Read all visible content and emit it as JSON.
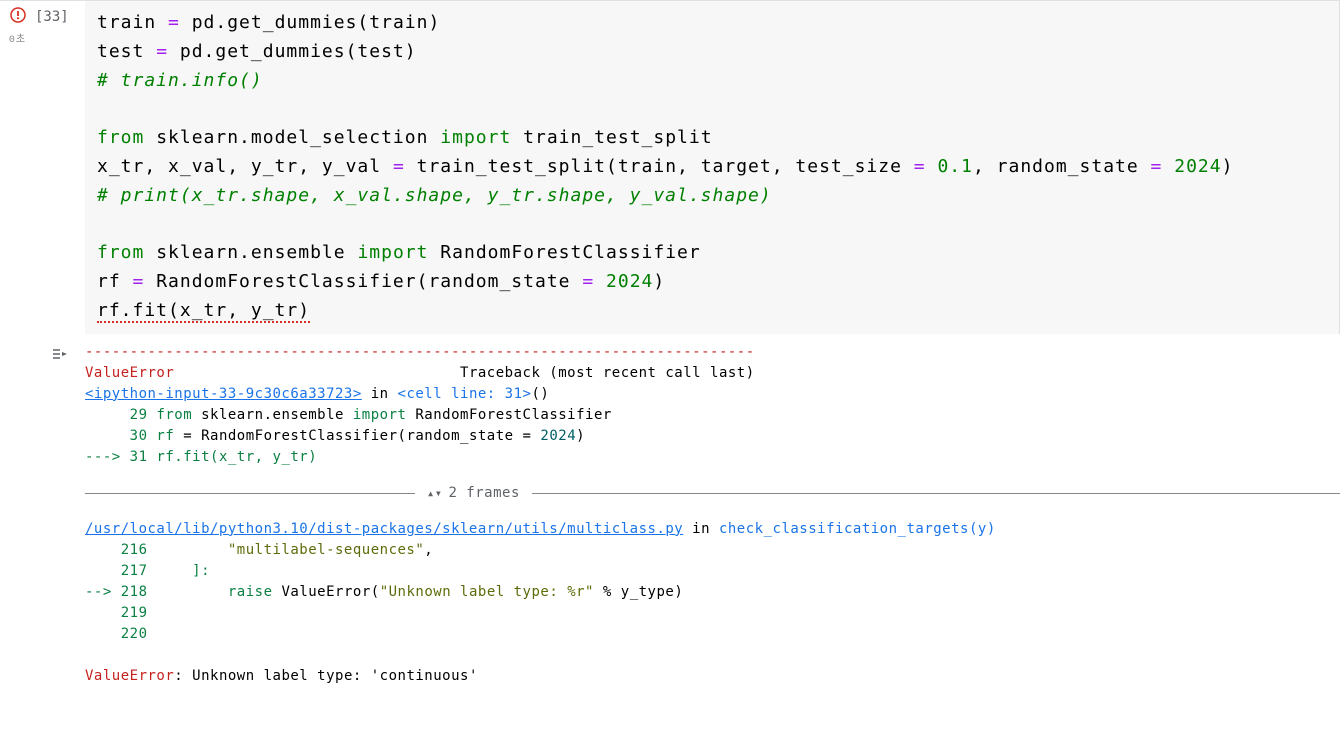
{
  "cell": {
    "execution_count": "[33]",
    "duration": "0초",
    "code": {
      "l1_a": "train ",
      "l1_b": "=",
      "l1_c": " pd.get_dummies(train)",
      "l2_a": "test ",
      "l2_b": "=",
      "l2_c": " pd.get_dummies(test)",
      "l3": "# train.info()",
      "l5_from": "from",
      "l5_mod": " sklearn.model_selection ",
      "l5_import": "import",
      "l5_rest": " train_test_split",
      "l6_a": "x_tr, x_val, y_tr, y_val ",
      "l6_b": "=",
      "l6_c": " train_test_split(train, target, test_size ",
      "l6_d": "=",
      "l6_e": " ",
      "l6_num1": "0.1",
      "l6_f": ", random_state ",
      "l6_g": "=",
      "l6_h": " ",
      "l6_num2": "2024",
      "l6_i": ")",
      "l7": "# print(x_tr.shape, x_val.shape, y_tr.shape, y_val.shape)",
      "l9_from": "from",
      "l9_mod": " sklearn.ensemble ",
      "l9_import": "import",
      "l9_rest": " RandomForestClassifier",
      "l10_a": "rf ",
      "l10_b": "=",
      "l10_c": " RandomForestClassifier(random_state ",
      "l10_d": "=",
      "l10_e": " ",
      "l10_num": "2024",
      "l10_f": ")",
      "l11": "rf.fit(x_tr, y_tr)"
    }
  },
  "output": {
    "sep": "---------------------------------------------------------------------------",
    "err_name": "ValueError",
    "traceback_label": "                                Traceback (most recent call last)",
    "ipython_link": "<ipython-input-33-9c30c6a33723>",
    "in": " in ",
    "cell_line": "<cell line: 31>",
    "paren": "()",
    "stack1_n1": "     29 ",
    "stack1_l1a": "from",
    "stack1_l1b": " sklearn.ensemble ",
    "stack1_l1c": "import",
    "stack1_l1d": " RandomForestClassifier",
    "stack1_n2": "     30 rf ",
    "stack1_l2a": "=",
    "stack1_l2b": " RandomForestClassifier(random_state ",
    "stack1_l2c": "=",
    "stack1_l2d": " ",
    "stack1_l2num": "2024",
    "stack1_l2e": ")",
    "stack1_arrow": "---> ",
    "stack1_n3": "31 rf.fit(x_tr, y_tr)",
    "frames_label": "2 frames",
    "file_link": "/usr/local/lib/python3.10/dist-packages/sklearn/utils/multiclass.py",
    "func": "check_classification_targets(y)",
    "stack2_n1": "    216         ",
    "stack2_l1": "\"multilabel-sequences\"",
    "stack2_l1b": ",",
    "stack2_n2": "    217     ]:",
    "stack2_arrow": "--> ",
    "stack2_n3": "218         ",
    "stack2_raise": "raise",
    "stack2_l3a": " ValueError(",
    "stack2_l3str": "\"Unknown label type: %r\"",
    "stack2_l3b": " % y_type)",
    "stack2_n4": "    219",
    "stack2_n5": "    220",
    "final_err": "ValueError",
    "final_msg": ": Unknown label type: 'continuous'"
  }
}
